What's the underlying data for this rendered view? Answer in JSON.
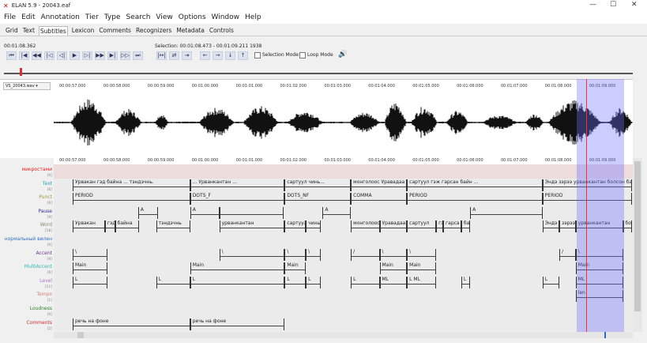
{
  "window": {
    "title": "ELAN 5.9 - 20043.eaf",
    "min": "—",
    "max": "☐",
    "close": "✕"
  },
  "menu": [
    "File",
    "Edit",
    "Annotation",
    "Tier",
    "Type",
    "Search",
    "View",
    "Options",
    "Window",
    "Help"
  ],
  "tabs": [
    "Grid",
    "Text",
    "Subtitles",
    "Lexicon",
    "Comments",
    "Recognizers",
    "Metadata",
    "Controls"
  ],
  "active_tab": "Subtitles",
  "media": {
    "current_time": "00:01:08.362",
    "selection": "Selection: 00:01:08.473 - 00:01:09.211  1938",
    "selection_mode": "Selection Mode",
    "loop_mode": "Loop Mode",
    "file": "VS_20043.wav"
  },
  "player_buttons": [
    "⏮",
    "|◀",
    "◀◀",
    "|◁",
    "◁|",
    "▶",
    "▷|",
    "▶▶",
    "▶|",
    "▷▷",
    "⏭"
  ],
  "selection_buttons": [
    "|↔|",
    "⇄",
    "⇥"
  ],
  "nav_buttons": [
    "←",
    "→",
    "↓",
    "↑"
  ],
  "ticks": [
    "00:00:57.000",
    "00:00:58.000",
    "00:00:59.000",
    "00:01:00.000",
    "00:01:01.000",
    "00:01:02.000",
    "00:01:03.000",
    "00:01:04.000",
    "00:01:05.000",
    "00:01:06.000",
    "00:01:07.000",
    "00:01:08.000",
    "00:01:09.000"
  ],
  "tiers": [
    {
      "name": "микростами",
      "count": "[0]",
      "color": "#e02020",
      "annotations": []
    },
    {
      "name": "Text",
      "count": "[6]",
      "color": "#2aa0b8",
      "annotations": [
        [
          57.34,
          60.0,
          "Урвакан гэд байна ... тэндэчнь."
        ],
        [
          60.0,
          62.14,
          "... Урванкантан ..."
        ],
        [
          62.14,
          63.64,
          "сартуул чинь..."
        ],
        [
          63.64,
          64.91,
          "монголоос Уравадаа"
        ],
        [
          64.91,
          67.98,
          "сартуул гэж гарсан байн ..."
        ],
        [
          67.98,
          70.0,
          "Эндэ зэрээ урванкантан болсон байн"
        ]
      ]
    },
    {
      "name": "Punct",
      "count": "[6]",
      "color": "#9a9a40",
      "annotations": [
        [
          57.34,
          60.0,
          "PERIOD"
        ],
        [
          60.0,
          62.14,
          "DOTS_F"
        ],
        [
          62.14,
          63.64,
          "DOTS_NF"
        ],
        [
          63.64,
          64.91,
          "COMMA"
        ],
        [
          64.91,
          67.98,
          "PERIOD"
        ],
        [
          67.98,
          70.0,
          "PERIOD"
        ]
      ]
    },
    {
      "name": "Pause",
      "count": "[9]",
      "color": "#303090",
      "annotations": [
        [
          58.82,
          59.27,
          "A"
        ],
        [
          60.0,
          60.66,
          "A"
        ],
        [
          60.66,
          62.12,
          ""
        ],
        [
          63.0,
          63.64,
          "A"
        ],
        [
          66.34,
          67.98,
          "A"
        ]
      ]
    },
    {
      "name": "Word",
      "count": "[18]",
      "color": "#8a8a70",
      "annotations": [
        [
          57.34,
          58.07,
          "Урвакан"
        ],
        [
          58.07,
          58.3,
          "гэд"
        ],
        [
          58.3,
          58.84,
          "байна"
        ],
        [
          59.23,
          60.0,
          "тэндэчнь"
        ],
        [
          60.66,
          62.14,
          "урванкантан"
        ],
        [
          62.14,
          62.62,
          "сартуул"
        ],
        [
          62.62,
          62.96,
          "чинь"
        ],
        [
          63.64,
          64.29,
          "монголоос"
        ],
        [
          64.29,
          64.91,
          "Уравадаа"
        ],
        [
          64.91,
          65.57,
          "сартуул"
        ],
        [
          65.57,
          65.73,
          "гэ"
        ],
        [
          65.73,
          66.14,
          "гарса"
        ],
        [
          66.14,
          66.34,
          "ба"
        ],
        [
          67.98,
          68.36,
          "Эндэ"
        ],
        [
          68.36,
          68.73,
          "зэрээ"
        ],
        [
          68.73,
          69.8,
          "урванкантан"
        ],
        [
          69.8,
          70.0,
          "бо"
        ]
      ]
    },
    {
      "name": "нормальный вилен",
      "count": "[0]",
      "color": "#3070c0",
      "annotations": []
    },
    {
      "name": "Accent",
      "count": "[9]",
      "color": "#703090",
      "annotations": [
        [
          57.34,
          58.13,
          "\\"
        ],
        [
          60.66,
          62.14,
          "\\"
        ],
        [
          62.14,
          62.62,
          "\\"
        ],
        [
          62.62,
          62.96,
          "\\"
        ],
        [
          63.64,
          64.29,
          "/"
        ],
        [
          64.29,
          64.91,
          "\\"
        ],
        [
          64.91,
          65.57,
          "\\"
        ],
        [
          68.36,
          68.73,
          "/"
        ],
        [
          68.73,
          69.8,
          "\\"
        ]
      ]
    },
    {
      "name": "MultiAccent",
      "count": "[6]",
      "color": "#30b8b0",
      "annotations": [
        [
          57.34,
          58.13,
          "Main"
        ],
        [
          60.0,
          62.14,
          "Main"
        ],
        [
          62.14,
          62.62,
          "Main"
        ],
        [
          64.29,
          64.91,
          "Main"
        ],
        [
          64.91,
          65.57,
          "Main"
        ],
        [
          68.73,
          69.8,
          "Main"
        ]
      ]
    },
    {
      "name": "Level",
      "count": "[11]",
      "color": "#b070c0",
      "annotations": [
        [
          57.34,
          58.13,
          "L"
        ],
        [
          59.23,
          60.0,
          "L"
        ],
        [
          60.0,
          62.14,
          "L"
        ],
        [
          62.14,
          62.62,
          "L"
        ],
        [
          62.62,
          62.96,
          "L"
        ],
        [
          63.64,
          64.29,
          "L"
        ],
        [
          64.29,
          64.91,
          "ML"
        ],
        [
          64.91,
          65.57,
          "L ML"
        ],
        [
          66.14,
          66.34,
          "L"
        ],
        [
          67.98,
          68.36,
          "L"
        ],
        [
          68.73,
          69.8,
          "ML"
        ]
      ]
    },
    {
      "name": "Tempo",
      "count": "[1]",
      "color": "#d08080",
      "annotations": [
        [
          68.73,
          69.8,
          "len"
        ]
      ]
    },
    {
      "name": "Loudness",
      "count": "[0]",
      "color": "#308030",
      "annotations": []
    },
    {
      "name": "Comments",
      "count": "[2]",
      "color": "#c03030",
      "annotations": [
        [
          57.34,
          60.0,
          "речь на фоне"
        ],
        [
          60.0,
          62.14,
          "речь на фоне"
        ]
      ]
    }
  ]
}
